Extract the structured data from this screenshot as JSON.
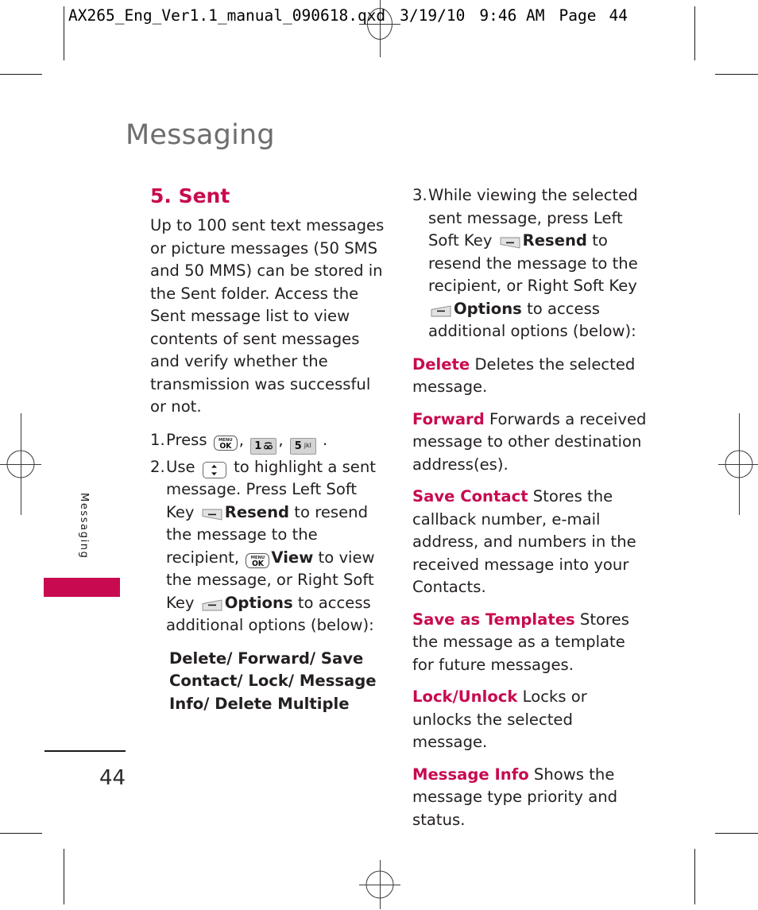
{
  "print_slug": {
    "filename": "AX265_Eng_Ver1.1_manual_090618.qxd",
    "date": "3/19/10",
    "time": "9:46 AM",
    "page_label": "Page",
    "page_number": "44"
  },
  "chapter": {
    "title": "Messaging",
    "side_tab_label": "Messaging",
    "accent_color": "#c80a50",
    "title_color": "#6e6e6e"
  },
  "folio": {
    "page_number": "44"
  },
  "left_column": {
    "section_heading": "5. Sent",
    "intro": "Up to 100 sent text messages or picture messages (50 SMS and 50 MMS) can be stored in the Sent folder. Access the Sent message list to view contents of sent messages and verify whether the transmission was successful or not.",
    "steps": [
      {
        "number": "1.",
        "parts": [
          {
            "type": "text",
            "value": "Press "
          },
          {
            "type": "key",
            "key": "menu-ok"
          },
          {
            "type": "text",
            "value": ", "
          },
          {
            "type": "key",
            "key": "num-1"
          },
          {
            "type": "text",
            "value": ", "
          },
          {
            "type": "key",
            "key": "num-5"
          },
          {
            "type": "text",
            "value": " ."
          }
        ]
      },
      {
        "number": "2.",
        "parts": [
          {
            "type": "text",
            "value": "Use "
          },
          {
            "type": "key",
            "key": "nav-updown"
          },
          {
            "type": "text",
            "value": " to highlight a sent message. Press Left Soft Key "
          },
          {
            "type": "key",
            "key": "left-soft"
          },
          {
            "type": "bold",
            "value": "Resend"
          },
          {
            "type": "text",
            "value": " to resend the message to the recipient, "
          },
          {
            "type": "key",
            "key": "menu-ok"
          },
          {
            "type": "bold",
            "value": "View"
          },
          {
            "type": "text",
            "value": " to view the message, or Right Soft Key "
          },
          {
            "type": "key",
            "key": "right-soft"
          },
          {
            "type": "bold",
            "value": "Options"
          },
          {
            "type": "text",
            "value": " to access additional options (below):"
          }
        ]
      }
    ],
    "options_summary": "Delete/ Forward/ Save Contact/ Lock/ Message Info/ Delete Multiple"
  },
  "right_column": {
    "step": {
      "number": "3.",
      "parts": [
        {
          "type": "text",
          "value": "While viewing the selected sent message, press Left Soft Key "
        },
        {
          "type": "key",
          "key": "left-soft"
        },
        {
          "type": "bold",
          "value": "Resend"
        },
        {
          "type": "text",
          "value": " to resend the message to the recipient, or Right Soft Key "
        },
        {
          "type": "key",
          "key": "right-soft"
        },
        {
          "type": "bold",
          "value": "Options"
        },
        {
          "type": "text",
          "value": " to access additional options (below):"
        }
      ]
    },
    "definitions": [
      {
        "term": "Delete",
        "desc": " Deletes the selected message."
      },
      {
        "term": "Forward",
        "desc": " Forwards a received message to other destination address(es)."
      },
      {
        "term": "Save Contact",
        "desc": " Stores the callback number, e-mail address, and numbers in the received message into your Contacts."
      },
      {
        "term": "Save as Templates",
        "desc": " Stores the message as a template for future messages."
      },
      {
        "term": "Lock/Unlock",
        "desc": " Locks or unlocks the selected message."
      },
      {
        "term": "Message Info",
        "desc": " Shows the message type priority and status."
      }
    ]
  },
  "keys": {
    "menu-ok": {
      "name": "menu-ok-key",
      "top_label": "MENU",
      "main_label": "OK"
    },
    "num-1": {
      "name": "number-1-key",
      "digit": "1",
      "sub": "voicemail-icon"
    },
    "num-5": {
      "name": "number-5-key",
      "digit": "5",
      "sub": "jkl"
    },
    "nav-updown": {
      "name": "navigation-up-down-key"
    },
    "left-soft": {
      "name": "left-soft-key-icon"
    },
    "right-soft": {
      "name": "right-soft-key-icon"
    }
  }
}
